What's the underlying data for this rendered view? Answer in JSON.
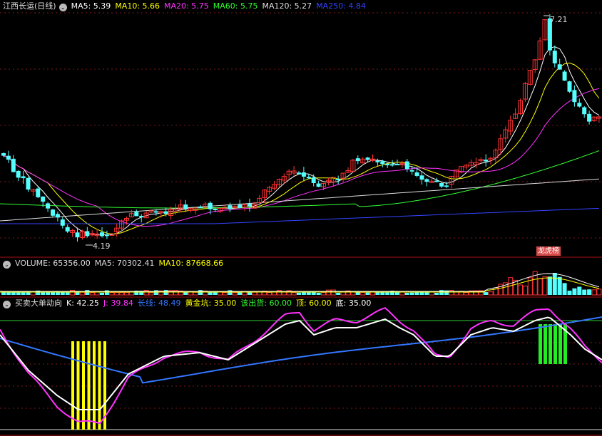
{
  "main": {
    "stock_name": "江西长运(日线)",
    "ma": [
      {
        "label": "MA5: 5.39",
        "color": "#ffffff"
      },
      {
        "label": "MA10: 5.66",
        "color": "#ffff00"
      },
      {
        "label": "MA20: 5.75",
        "color": "#ff33ff"
      },
      {
        "label": "MA60: 5.75",
        "color": "#33ff33"
      },
      {
        "label": "MA120: 5.27",
        "color": "#dddddd"
      },
      {
        "label": "MA250: 4.84",
        "color": "#3344ff"
      }
    ],
    "high_label": "7.21",
    "low_label": "4.19",
    "tag_label": "龙虎榜"
  },
  "volume": {
    "title": "VOLUME: 65356.00",
    "ma5": "MA5: 70302.41",
    "ma10": "MA10: 87668.66"
  },
  "indicator": {
    "name": "买卖大单动向",
    "items": [
      {
        "label": "K: 42.25",
        "color": "#ffffff"
      },
      {
        "label": "J: 39.84",
        "color": "#ff33ff"
      },
      {
        "label": "长线: 48.49",
        "color": "#3377ff"
      },
      {
        "label": "黄金坑: 35.00",
        "color": "#ffff00"
      },
      {
        "label": "该出货: 60.00",
        "color": "#33ff33"
      },
      {
        "label": "顶: 60.00",
        "color": "#ffff00"
      },
      {
        "label": "底: 35.00",
        "color": "#ffffff"
      }
    ]
  },
  "colors": {
    "up": "#ff3333",
    "down": "#54ffff",
    "grid": "#7a1a1a"
  }
}
